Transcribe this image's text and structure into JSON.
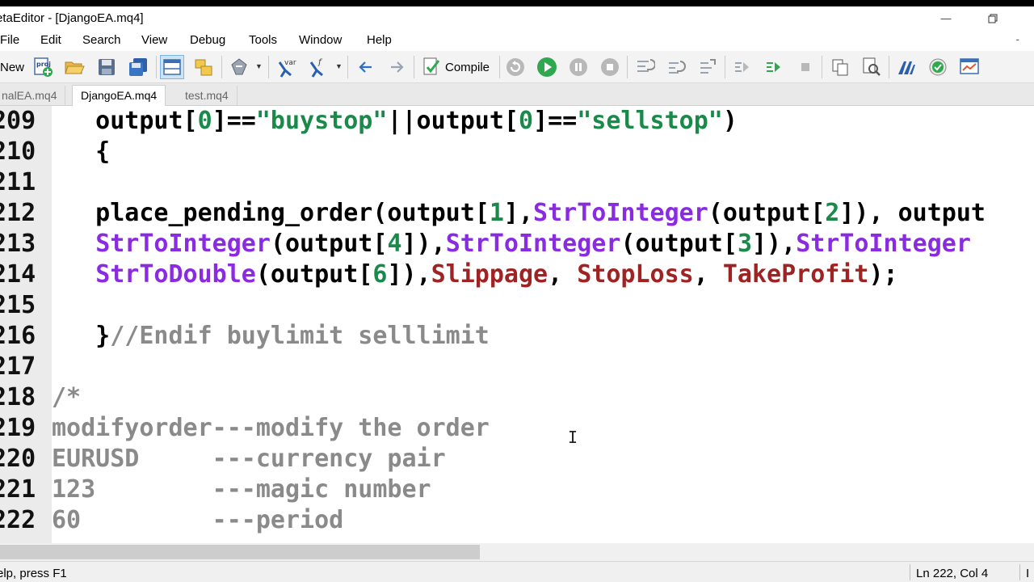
{
  "window": {
    "title": "etaEditor - [DjangoEA.mq4]"
  },
  "menu": {
    "items": [
      "File",
      "Edit",
      "Search",
      "View",
      "Debug",
      "Tools",
      "Window",
      "Help"
    ],
    "mdi_dash": "-"
  },
  "toolbar": {
    "new_label": "New",
    "compile_label": "Compile"
  },
  "tabs": [
    {
      "label": "nalEA.mq4",
      "active": false
    },
    {
      "label": "DjangoEA.mq4",
      "active": true
    },
    {
      "label": "test.mq4",
      "active": false
    }
  ],
  "code_lines": [
    {
      "num": "209",
      "segments": [
        {
          "t": "   output[",
          "c": "kw"
        },
        {
          "t": "0",
          "c": "num"
        },
        {
          "t": "]==",
          "c": "kw"
        },
        {
          "t": "\"buystop\"",
          "c": "str"
        },
        {
          "t": "||output[",
          "c": "kw"
        },
        {
          "t": "0",
          "c": "num"
        },
        {
          "t": "]==",
          "c": "kw"
        },
        {
          "t": "\"sellstop\"",
          "c": "str"
        },
        {
          "t": ")",
          "c": "kw"
        }
      ]
    },
    {
      "num": "210",
      "segments": [
        {
          "t": "   {",
          "c": "kw"
        }
      ]
    },
    {
      "num": "211",
      "segments": []
    },
    {
      "num": "212",
      "segments": [
        {
          "t": "   place_pending_order(output[",
          "c": "kw"
        },
        {
          "t": "1",
          "c": "num"
        },
        {
          "t": "],",
          "c": "kw"
        },
        {
          "t": "StrToInteger",
          "c": "fn"
        },
        {
          "t": "(output[",
          "c": "kw"
        },
        {
          "t": "2",
          "c": "num"
        },
        {
          "t": "]), output",
          "c": "kw"
        }
      ]
    },
    {
      "num": "213",
      "segments": [
        {
          "t": "   ",
          "c": "kw"
        },
        {
          "t": "StrToInteger",
          "c": "fn"
        },
        {
          "t": "(output[",
          "c": "kw"
        },
        {
          "t": "4",
          "c": "num"
        },
        {
          "t": "]),",
          "c": "kw"
        },
        {
          "t": "StrToInteger",
          "c": "fn"
        },
        {
          "t": "(output[",
          "c": "kw"
        },
        {
          "t": "3",
          "c": "num"
        },
        {
          "t": "]),",
          "c": "kw"
        },
        {
          "t": "StrToInteger",
          "c": "fn"
        }
      ]
    },
    {
      "num": "214",
      "segments": [
        {
          "t": "   ",
          "c": "kw"
        },
        {
          "t": "StrToDouble",
          "c": "fn"
        },
        {
          "t": "(output[",
          "c": "kw"
        },
        {
          "t": "6",
          "c": "num"
        },
        {
          "t": "]),",
          "c": "kw"
        },
        {
          "t": "Slippage",
          "c": "var"
        },
        {
          "t": ", ",
          "c": "kw"
        },
        {
          "t": "StopLoss",
          "c": "var"
        },
        {
          "t": ", ",
          "c": "kw"
        },
        {
          "t": "TakeProfit",
          "c": "var"
        },
        {
          "t": ");",
          "c": "kw"
        }
      ]
    },
    {
      "num": "215",
      "segments": []
    },
    {
      "num": "216",
      "segments": [
        {
          "t": "   }",
          "c": "kw"
        },
        {
          "t": "//Endif buylimit selllimit",
          "c": "cm"
        }
      ]
    },
    {
      "num": "217",
      "segments": []
    },
    {
      "num": "218",
      "segments": [
        {
          "t": "/*",
          "c": "cm"
        }
      ]
    },
    {
      "num": "219",
      "segments": [
        {
          "t": "modifyorder---modify the order",
          "c": "cm"
        }
      ]
    },
    {
      "num": "220",
      "segments": [
        {
          "t": "EURUSD     ---currency pair",
          "c": "cm"
        }
      ]
    },
    {
      "num": "221",
      "segments": [
        {
          "t": "123        ---magic number",
          "c": "cm"
        }
      ]
    },
    {
      "num": "222",
      "segments": [
        {
          "t": "60         ---period",
          "c": "cm"
        }
      ]
    }
  ],
  "status": {
    "hint": "elp, press F1",
    "position": "Ln 222, Col 4",
    "extra": "I"
  },
  "colors": {
    "string": "#1a8a4a",
    "function": "#8a2be2",
    "variable": "#a02323",
    "comment": "#8a8a8a"
  }
}
